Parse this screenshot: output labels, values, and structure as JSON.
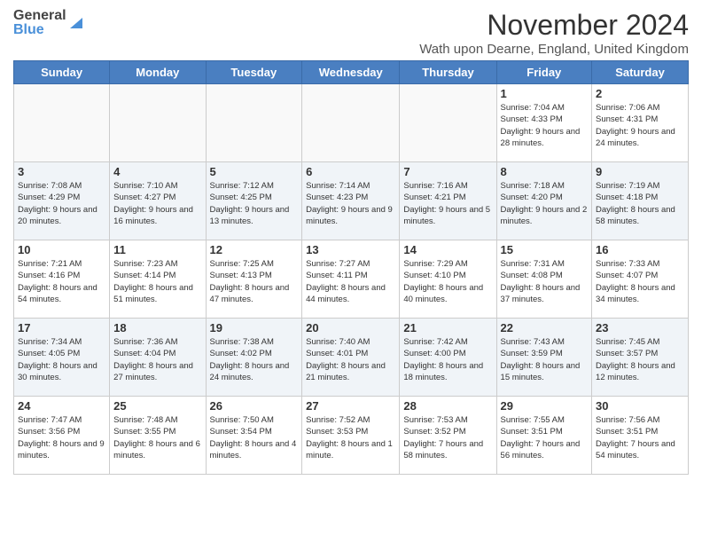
{
  "header": {
    "logo_general": "General",
    "logo_blue": "Blue",
    "month_title": "November 2024",
    "location": "Wath upon Dearne, England, United Kingdom"
  },
  "days_of_week": [
    "Sunday",
    "Monday",
    "Tuesday",
    "Wednesday",
    "Thursday",
    "Friday",
    "Saturday"
  ],
  "weeks": [
    [
      {
        "day": "",
        "info": ""
      },
      {
        "day": "",
        "info": ""
      },
      {
        "day": "",
        "info": ""
      },
      {
        "day": "",
        "info": ""
      },
      {
        "day": "",
        "info": ""
      },
      {
        "day": "1",
        "info": "Sunrise: 7:04 AM\nSunset: 4:33 PM\nDaylight: 9 hours and 28 minutes."
      },
      {
        "day": "2",
        "info": "Sunrise: 7:06 AM\nSunset: 4:31 PM\nDaylight: 9 hours and 24 minutes."
      }
    ],
    [
      {
        "day": "3",
        "info": "Sunrise: 7:08 AM\nSunset: 4:29 PM\nDaylight: 9 hours and 20 minutes."
      },
      {
        "day": "4",
        "info": "Sunrise: 7:10 AM\nSunset: 4:27 PM\nDaylight: 9 hours and 16 minutes."
      },
      {
        "day": "5",
        "info": "Sunrise: 7:12 AM\nSunset: 4:25 PM\nDaylight: 9 hours and 13 minutes."
      },
      {
        "day": "6",
        "info": "Sunrise: 7:14 AM\nSunset: 4:23 PM\nDaylight: 9 hours and 9 minutes."
      },
      {
        "day": "7",
        "info": "Sunrise: 7:16 AM\nSunset: 4:21 PM\nDaylight: 9 hours and 5 minutes."
      },
      {
        "day": "8",
        "info": "Sunrise: 7:18 AM\nSunset: 4:20 PM\nDaylight: 9 hours and 2 minutes."
      },
      {
        "day": "9",
        "info": "Sunrise: 7:19 AM\nSunset: 4:18 PM\nDaylight: 8 hours and 58 minutes."
      }
    ],
    [
      {
        "day": "10",
        "info": "Sunrise: 7:21 AM\nSunset: 4:16 PM\nDaylight: 8 hours and 54 minutes."
      },
      {
        "day": "11",
        "info": "Sunrise: 7:23 AM\nSunset: 4:14 PM\nDaylight: 8 hours and 51 minutes."
      },
      {
        "day": "12",
        "info": "Sunrise: 7:25 AM\nSunset: 4:13 PM\nDaylight: 8 hours and 47 minutes."
      },
      {
        "day": "13",
        "info": "Sunrise: 7:27 AM\nSunset: 4:11 PM\nDaylight: 8 hours and 44 minutes."
      },
      {
        "day": "14",
        "info": "Sunrise: 7:29 AM\nSunset: 4:10 PM\nDaylight: 8 hours and 40 minutes."
      },
      {
        "day": "15",
        "info": "Sunrise: 7:31 AM\nSunset: 4:08 PM\nDaylight: 8 hours and 37 minutes."
      },
      {
        "day": "16",
        "info": "Sunrise: 7:33 AM\nSunset: 4:07 PM\nDaylight: 8 hours and 34 minutes."
      }
    ],
    [
      {
        "day": "17",
        "info": "Sunrise: 7:34 AM\nSunset: 4:05 PM\nDaylight: 8 hours and 30 minutes."
      },
      {
        "day": "18",
        "info": "Sunrise: 7:36 AM\nSunset: 4:04 PM\nDaylight: 8 hours and 27 minutes."
      },
      {
        "day": "19",
        "info": "Sunrise: 7:38 AM\nSunset: 4:02 PM\nDaylight: 8 hours and 24 minutes."
      },
      {
        "day": "20",
        "info": "Sunrise: 7:40 AM\nSunset: 4:01 PM\nDaylight: 8 hours and 21 minutes."
      },
      {
        "day": "21",
        "info": "Sunrise: 7:42 AM\nSunset: 4:00 PM\nDaylight: 8 hours and 18 minutes."
      },
      {
        "day": "22",
        "info": "Sunrise: 7:43 AM\nSunset: 3:59 PM\nDaylight: 8 hours and 15 minutes."
      },
      {
        "day": "23",
        "info": "Sunrise: 7:45 AM\nSunset: 3:57 PM\nDaylight: 8 hours and 12 minutes."
      }
    ],
    [
      {
        "day": "24",
        "info": "Sunrise: 7:47 AM\nSunset: 3:56 PM\nDaylight: 8 hours and 9 minutes."
      },
      {
        "day": "25",
        "info": "Sunrise: 7:48 AM\nSunset: 3:55 PM\nDaylight: 8 hours and 6 minutes."
      },
      {
        "day": "26",
        "info": "Sunrise: 7:50 AM\nSunset: 3:54 PM\nDaylight: 8 hours and 4 minutes."
      },
      {
        "day": "27",
        "info": "Sunrise: 7:52 AM\nSunset: 3:53 PM\nDaylight: 8 hours and 1 minute."
      },
      {
        "day": "28",
        "info": "Sunrise: 7:53 AM\nSunset: 3:52 PM\nDaylight: 7 hours and 58 minutes."
      },
      {
        "day": "29",
        "info": "Sunrise: 7:55 AM\nSunset: 3:51 PM\nDaylight: 7 hours and 56 minutes."
      },
      {
        "day": "30",
        "info": "Sunrise: 7:56 AM\nSunset: 3:51 PM\nDaylight: 7 hours and 54 minutes."
      }
    ]
  ]
}
